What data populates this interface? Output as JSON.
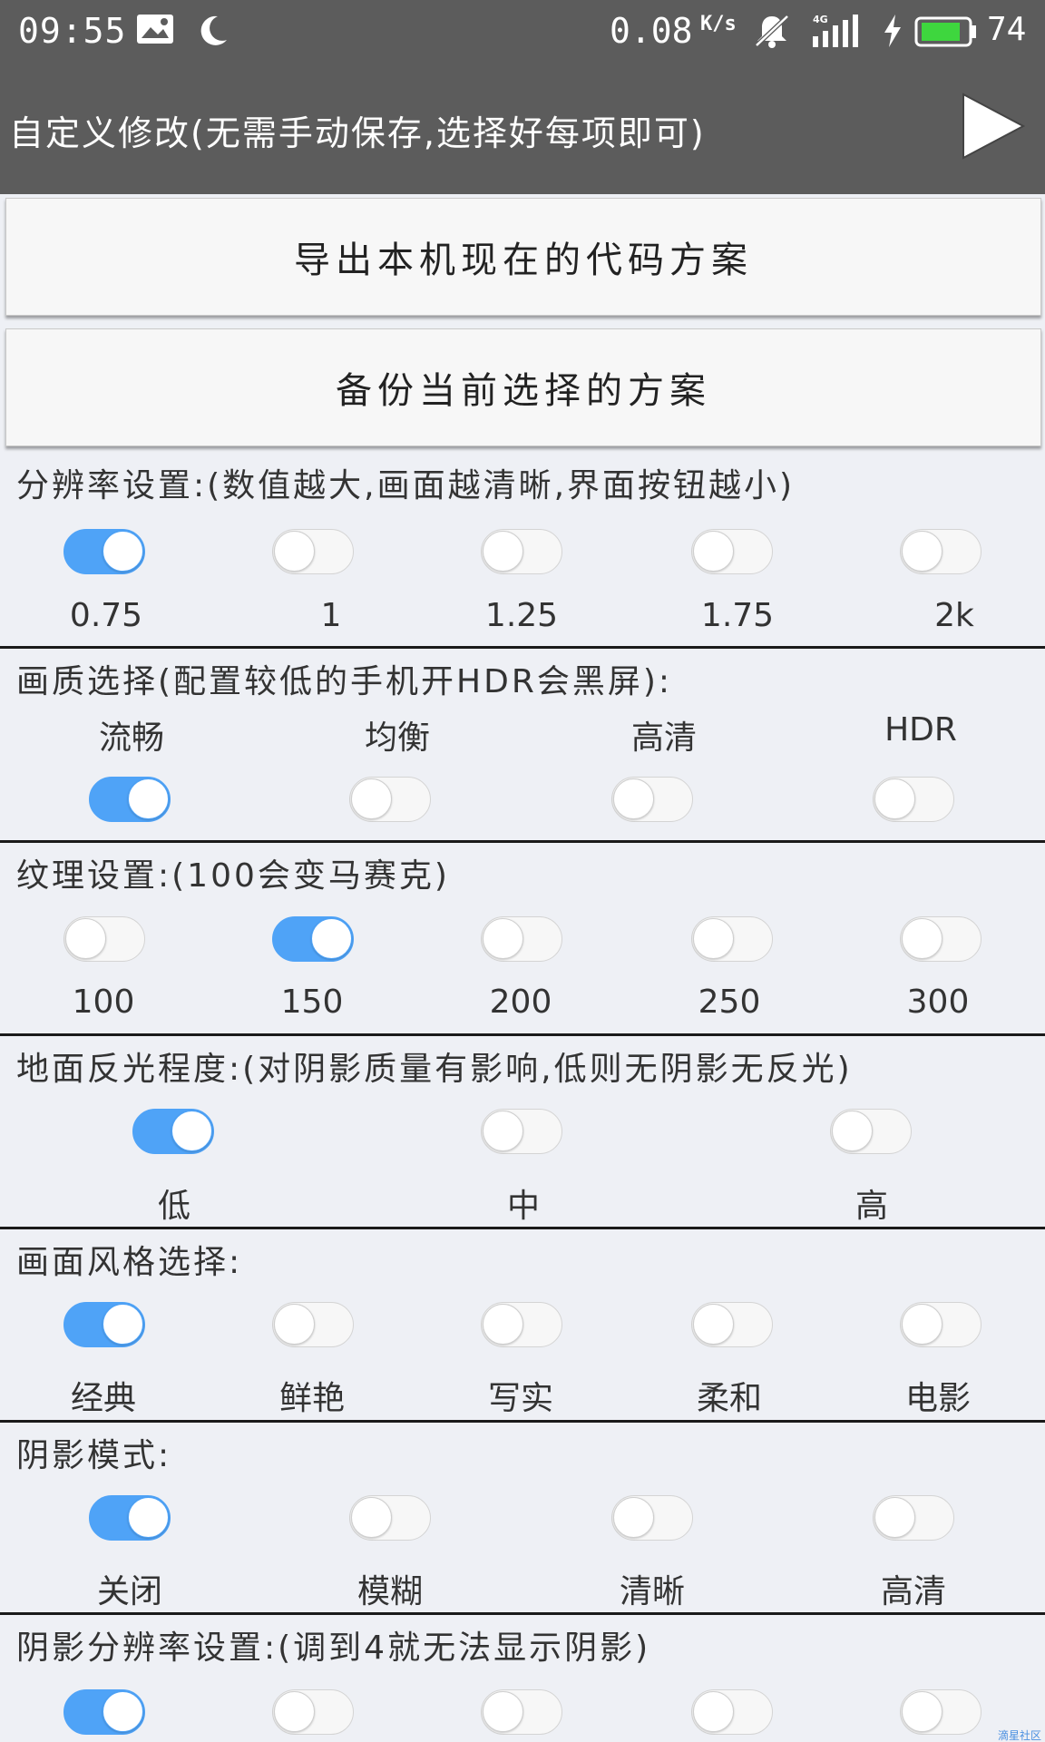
{
  "status_bar": {
    "time": "09:55",
    "speed": "0.08",
    "speed_unit": "K/s",
    "battery": "74",
    "icons": [
      "gallery-icon",
      "moon-icon",
      "mute-icon",
      "signal-4g-icon",
      "charging-icon",
      "battery-icon"
    ]
  },
  "title_bar": {
    "title": "自定义修改(无需手动保存,选择好每项即可)",
    "play_icon": "play-icon"
  },
  "buttons": {
    "export": "导出本机现在的代码方案",
    "backup": "备份当前选择的方案"
  },
  "sections": {
    "resolution": {
      "title": "分辨率设置:(数值越大,画面越清晰,界面按钮越小)",
      "options": [
        "0.75",
        "1",
        "1.25",
        "1.75",
        "2k"
      ],
      "selected": 0
    },
    "quality": {
      "title": "画质选择(配置较低的手机开HDR会黑屏):",
      "options": [
        "流畅",
        "均衡",
        "高清",
        "HDR"
      ],
      "selected": 0
    },
    "texture": {
      "title": "纹理设置:(100会变马赛克)",
      "options": [
        "100",
        "150",
        "200",
        "250",
        "300"
      ],
      "selected": 1
    },
    "reflection": {
      "title": "地面反光程度:(对阴影质量有影响,低则无阴影无反光)",
      "options": [
        "低",
        "中",
        "高"
      ],
      "selected": 0
    },
    "style": {
      "title": "画面风格选择:",
      "options": [
        "经典",
        "鲜艳",
        "写实",
        "柔和",
        "电影"
      ],
      "selected": 0
    },
    "shadow_mode": {
      "title": "阴影模式:",
      "options": [
        "关闭",
        "模糊",
        "清晰",
        "高清"
      ],
      "selected": 0
    },
    "shadow_resolution": {
      "title": "阴影分辨率设置:(调到4就无法显示阴影)",
      "selected": 0
    }
  },
  "watermark": "滴星社区",
  "colors": {
    "bar": "#5c5c5c",
    "toggle_on": "#4fa3f7",
    "background": "#eef0f5"
  }
}
